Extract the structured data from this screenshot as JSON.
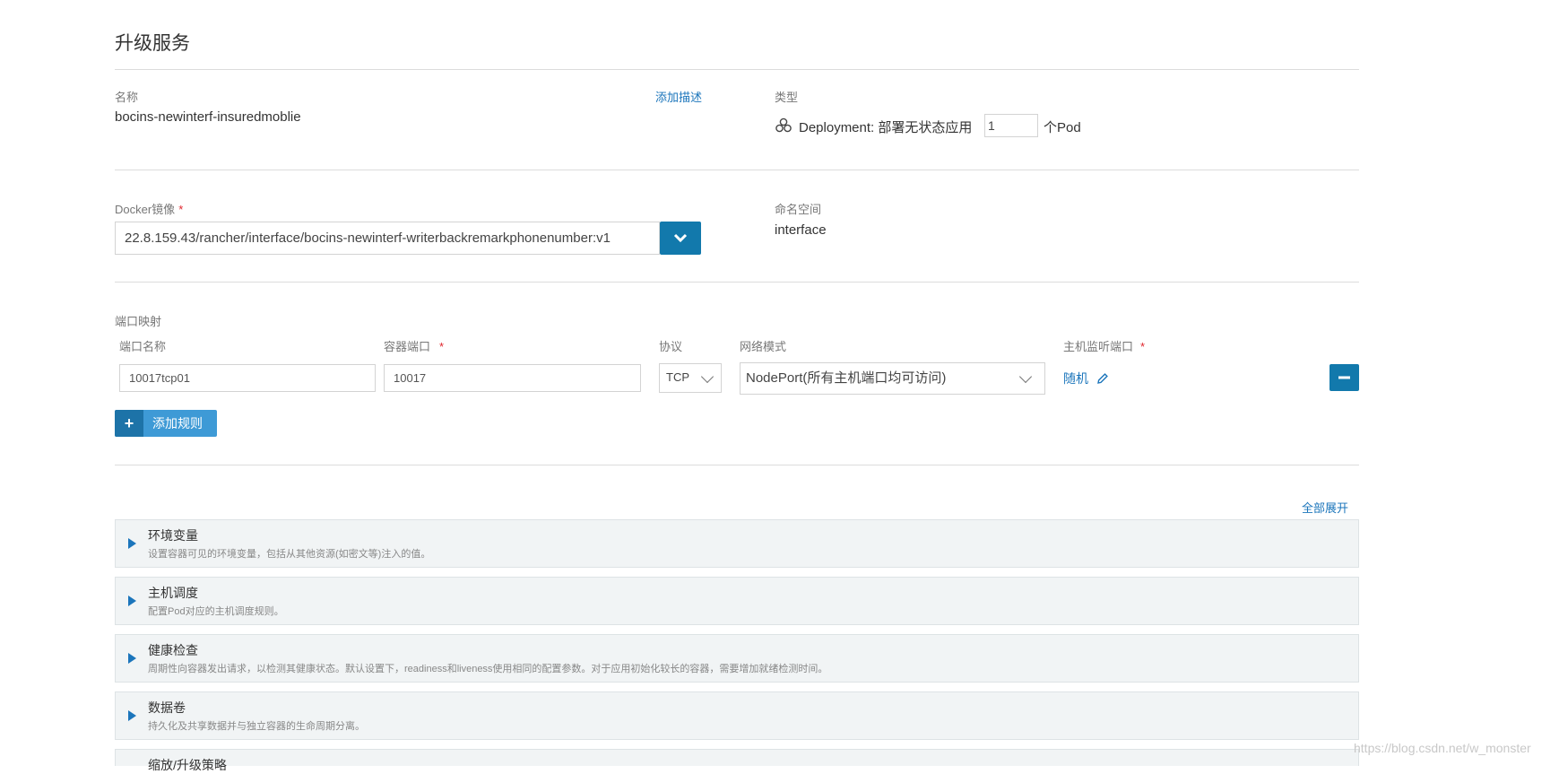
{
  "page_title": "升级服务",
  "name_section": {
    "name_label": "名称",
    "name_value": "bocins-newinterf-insuredmoblie",
    "add_description": "添加描述",
    "type_label": "类型",
    "type_value": "Deployment: 部署无状态应用",
    "pod_count": "1",
    "pod_suffix": "个Pod"
  },
  "image_section": {
    "docker_label": "Docker镜像",
    "required_mark": "*",
    "docker_value": "22.8.159.43/rancher/interface/bocins-newinterf-writerbackremarkphonenumber:v1",
    "namespace_label": "命名空间",
    "namespace_value": "interface"
  },
  "ports": {
    "section_label": "端口映射",
    "col_name": "端口名称",
    "col_container_port": "容器端口",
    "col_protocol": "协议",
    "col_network_mode": "网络模式",
    "col_host_port": "主机监听端口",
    "required_mark": "*",
    "row": {
      "name": "10017tcp01",
      "container_port": "10017",
      "protocol": "TCP",
      "network_mode": "NodePort(所有主机端口均可访问)",
      "host_port": "随机"
    },
    "add_rule": "添加规则"
  },
  "expand_all": "全部展开",
  "panels": [
    {
      "title": "环境变量",
      "desc": "设置容器可见的环境变量，包括从其他资源(如密文等)注入的值。"
    },
    {
      "title": "主机调度",
      "desc": "配置Pod对应的主机调度规则。"
    },
    {
      "title": "健康检查",
      "desc": "周期性向容器发出请求，以检测其健康状态。默认设置下，readiness和liveness使用相同的配置参数。对于应用初始化较长的容器，需要增加就绪检测时间。"
    },
    {
      "title": "数据卷",
      "desc": "持久化及共享数据并与独立容器的生命周期分离。"
    },
    {
      "title": "缩放/升级策略",
      "desc": ""
    }
  ],
  "watermark": "https://blog.csdn.net/w_monster",
  "colors": {
    "accent": "#1b75bb",
    "button": "#1279ac",
    "add_button": "#3e9ad6"
  }
}
